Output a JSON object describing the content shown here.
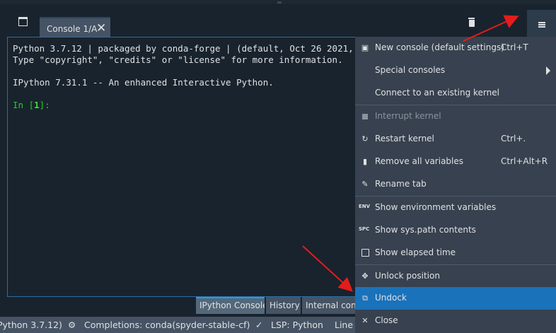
{
  "console_tab": {
    "label": "Console 1/A",
    "close": "✕"
  },
  "console_output": {
    "line1": "Python 3.7.12 | packaged by conda-forge | (default, Oct 26 2021,",
    "line2": "Type \"copyright\", \"credits\" or \"license\" for more information.",
    "line3": "IPython 7.31.1 -- An enhanced Interactive Python.",
    "prompt_prefix": "In [",
    "prompt_num": "1",
    "prompt_suffix": "]:"
  },
  "bottom_tabs": [
    {
      "label": "IPython Console",
      "active": true
    },
    {
      "label": "History",
      "active": false
    },
    {
      "label": "Internal conso",
      "active": false
    }
  ],
  "status_bar": {
    "python": "Python 3.7.12)",
    "completions": "Completions: conda(spyder-stable-cf)",
    "lsp": "LSP: Python",
    "line": "Line"
  },
  "menu": {
    "new_console": {
      "label": "New console (default settings)",
      "shortcut": "Ctrl+T",
      "icon": "terminal-icon"
    },
    "special_consoles": {
      "label": "Special consoles"
    },
    "connect_kernel": {
      "label": "Connect to an existing kernel"
    },
    "interrupt_kernel": {
      "label": "Interrupt kernel",
      "icon": "stop-icon"
    },
    "restart_kernel": {
      "label": "Restart kernel",
      "shortcut": "Ctrl+.",
      "icon": "restart-icon"
    },
    "remove_variables": {
      "label": "Remove all variables",
      "shortcut": "Ctrl+Alt+R",
      "icon": "trash-icon"
    },
    "rename_tab": {
      "label": "Rename tab",
      "icon": "edit-icon"
    },
    "show_env": {
      "label": "Show environment variables",
      "tag": "ENV"
    },
    "show_syspath": {
      "label": "Show sys.path contents",
      "tag": "SPC"
    },
    "show_elapsed": {
      "label": "Show elapsed time"
    },
    "unlock_position": {
      "label": "Unlock position",
      "icon": "move-icon"
    },
    "undock": {
      "label": "Undock",
      "icon": "undock-icon"
    },
    "close": {
      "label": "Close",
      "icon": "close-icon"
    }
  },
  "colors": {
    "accent": "#1a72bb",
    "annotation_arrow": "#e51c1c"
  }
}
